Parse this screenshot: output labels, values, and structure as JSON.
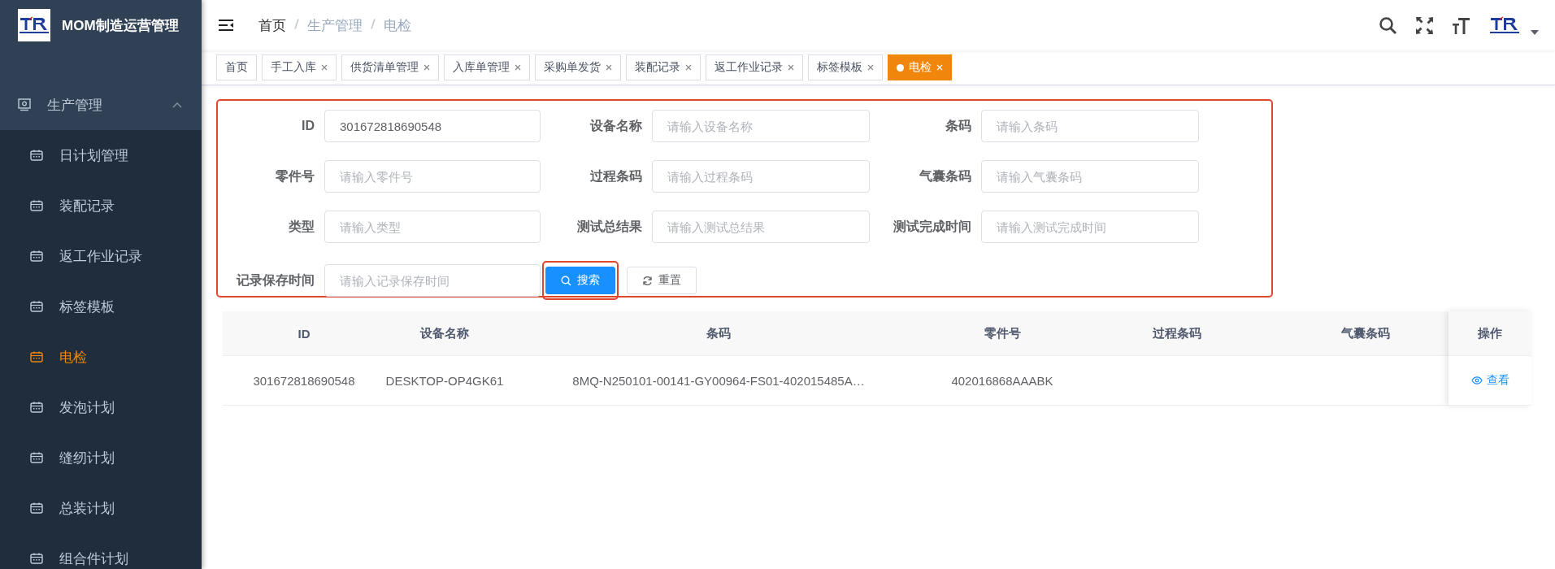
{
  "app": {
    "title": "MOM制造运营管理"
  },
  "sidebar": {
    "group": {
      "label": "生产管理",
      "expanded": true
    },
    "items": [
      {
        "label": "日计划管理",
        "selected": false
      },
      {
        "label": "装配记录",
        "selected": false
      },
      {
        "label": "返工作业记录",
        "selected": false
      },
      {
        "label": "标签模板",
        "selected": false
      },
      {
        "label": "电检",
        "selected": true
      },
      {
        "label": "发泡计划",
        "selected": false
      },
      {
        "label": "缝纫计划",
        "selected": false
      },
      {
        "label": "总装计划",
        "selected": false
      },
      {
        "label": "组合件计划",
        "selected": false
      }
    ]
  },
  "breadcrumb": [
    "首页",
    "生产管理",
    "电检"
  ],
  "tags": [
    {
      "label": "首页",
      "closable": false,
      "selected": false
    },
    {
      "label": "手工入库",
      "closable": true,
      "selected": false
    },
    {
      "label": "供货清单管理",
      "closable": true,
      "selected": false
    },
    {
      "label": "入库单管理",
      "closable": true,
      "selected": false
    },
    {
      "label": "采购单发货",
      "closable": true,
      "selected": false
    },
    {
      "label": "装配记录",
      "closable": true,
      "selected": false
    },
    {
      "label": "返工作业记录",
      "closable": true,
      "selected": false
    },
    {
      "label": "标签模板",
      "closable": true,
      "selected": false
    },
    {
      "label": "电检",
      "closable": true,
      "selected": true
    }
  ],
  "form": {
    "fields": [
      {
        "label": "ID",
        "value": "301672818690548"
      },
      {
        "label": "设备名称",
        "placeholder": "请输入设备名称"
      },
      {
        "label": "条码",
        "placeholder": "请输入条码"
      },
      {
        "label": "零件号",
        "placeholder": "请输入零件号"
      },
      {
        "label": "过程条码",
        "placeholder": "请输入过程条码"
      },
      {
        "label": "气囊条码",
        "placeholder": "请输入气囊条码"
      },
      {
        "label": "类型",
        "placeholder": "请输入类型"
      },
      {
        "label": "测试总结果",
        "placeholder": "请输入测试总结果"
      },
      {
        "label": "测试完成时间",
        "placeholder": "请输入测试完成时间"
      },
      {
        "label": "记录保存时间",
        "placeholder": "请输入记录保存时间"
      }
    ],
    "search_button": "搜索",
    "reset_button": "重置"
  },
  "table": {
    "columns": [
      "ID",
      "设备名称",
      "条码",
      "零件号",
      "过程条码",
      "气囊条码"
    ],
    "action_column": "操作",
    "rows": [
      {
        "cells": [
          "301672818690548",
          "DESKTOP-OP4GK61",
          "8MQ-N250101-00141-GY00964-FS01-402015485A…",
          "402016868AAABK",
          "",
          ""
        ],
        "action": "查看"
      }
    ]
  }
}
